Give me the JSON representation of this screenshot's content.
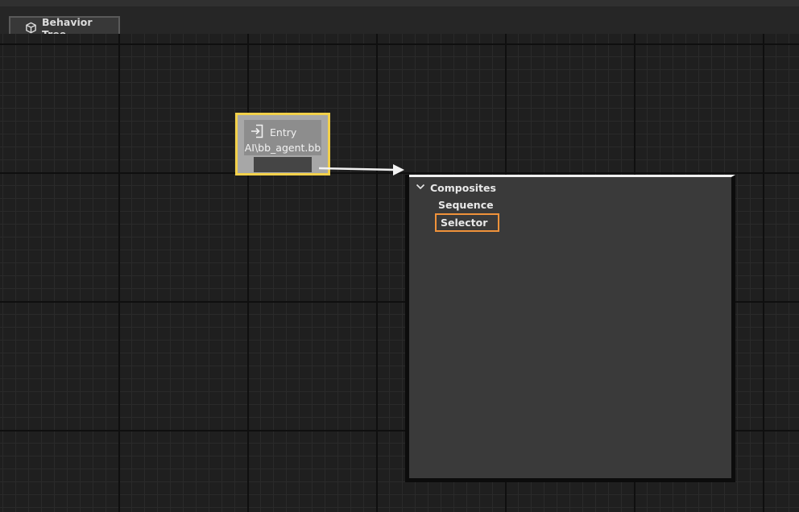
{
  "toolbar": {
    "tab_label": "Behavior Tree",
    "tab_icon": "cube-icon"
  },
  "entry_node": {
    "title": "Entry",
    "subtitle": "AI\\bb_agent.bb",
    "icon": "entry-icon",
    "border_color": "#f2d04a"
  },
  "popup": {
    "category": {
      "label": "Composites",
      "icon": "chevron-down-icon",
      "items": [
        {
          "label": "Sequence"
        },
        {
          "label": "Selector"
        }
      ]
    },
    "highlight_color": "#f0923a"
  }
}
